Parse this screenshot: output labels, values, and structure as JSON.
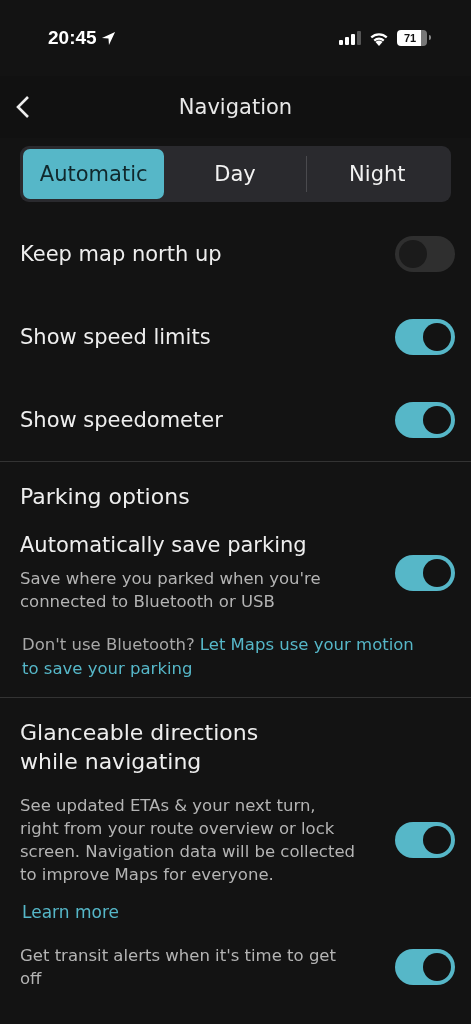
{
  "status_bar": {
    "time": "20:45",
    "battery": "71"
  },
  "header": {
    "title": "Navigation"
  },
  "segments": [
    {
      "label": "Automatic",
      "selected": true
    },
    {
      "label": "Day",
      "selected": false
    },
    {
      "label": "Night",
      "selected": false
    }
  ],
  "items": [
    {
      "kind": "toggle",
      "label": "Keep map north up",
      "on": false
    },
    {
      "kind": "toggle",
      "label": "Show speed limits",
      "on": true
    },
    {
      "kind": "toggle",
      "label": "Show speedometer",
      "on": true
    },
    {
      "kind": "divider"
    },
    {
      "kind": "heading",
      "label": "Parking options"
    },
    {
      "kind": "toggle",
      "label": "Automatically save parking",
      "description": "Save where you parked when you're connected to Bluetooth or USB",
      "on": true
    },
    {
      "kind": "note",
      "text": "Don't use Bluetooth?",
      "link_lines": [
        "Let Maps use your motion",
        "to save your parking"
      ]
    },
    {
      "kind": "divider"
    },
    {
      "kind": "heading",
      "label": "Glanceable directions while navigating"
    },
    {
      "kind": "toggle",
      "description": "See updated ETAs & your next turn, right from your route overview or lock screen. Navigation data will be collected to improve Maps for everyone.",
      "on": true
    },
    {
      "kind": "link",
      "link": "Learn more"
    },
    {
      "kind": "toggle",
      "description": "Get transit alerts when it's time to get off",
      "on": true
    }
  ]
}
